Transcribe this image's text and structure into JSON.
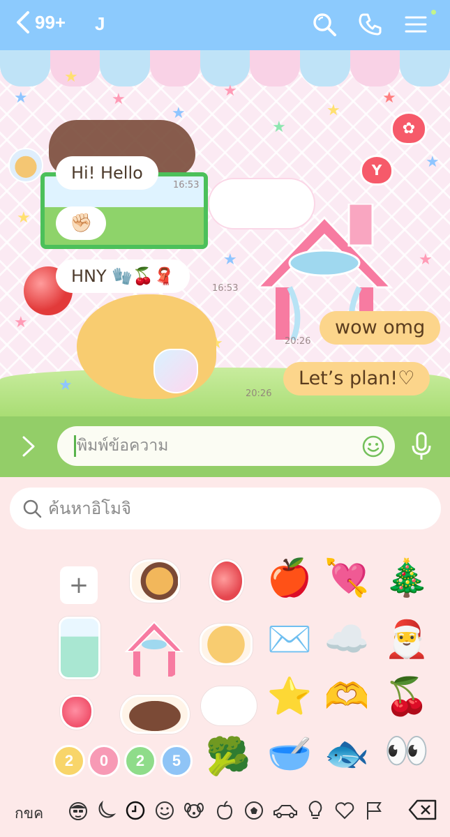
{
  "header": {
    "unread_count": "99+",
    "chat_name": "J",
    "bg_color": "#8ccafd"
  },
  "messages": [
    {
      "text": "Hi! Hello",
      "sender": "them",
      "time": "16:53"
    },
    {
      "text": "✊🏻",
      "sender": "them"
    },
    {
      "text": "HNY 🧤🍒🧣",
      "sender": "them",
      "time": "16:53"
    },
    {
      "text": "wow omg",
      "sender": "me",
      "time": "20:26"
    },
    {
      "text": "Let’s plan!♡",
      "sender": "me",
      "time": "20:26"
    }
  ],
  "input": {
    "placeholder": "พิมพ์ข้อความ"
  },
  "emoji_panel": {
    "search_placeholder": "ค้นหาอิโมจิ",
    "add_label": "+",
    "emojis": [
      "🍎",
      "💘",
      "🎄",
      "✉️",
      "☁️",
      "🎅",
      "⭐",
      "🫶",
      "🍒",
      "🥦",
      "🥣",
      "🐟",
      "👀"
    ],
    "stickers": [
      "dog-sticker",
      "cherry-sticker",
      "drink-sticker",
      "house-sticker",
      "puppy-sticker",
      "strawberry-sticker",
      "dachshund-sticker",
      "cat-sticker",
      "2025-sticker"
    ],
    "badges": [
      "2",
      "0",
      "2",
      "5"
    ],
    "category_label": "กขค",
    "categories": [
      "smile-face",
      "moon",
      "recent",
      "smiley",
      "dog",
      "apple",
      "soccer",
      "car",
      "bulb",
      "heart",
      "flag"
    ],
    "selected_category": "recent"
  },
  "colors": {
    "input_bar": "#93ce68",
    "panel_bg": "#fde9e9",
    "my_bubble": "#fcd58b"
  }
}
